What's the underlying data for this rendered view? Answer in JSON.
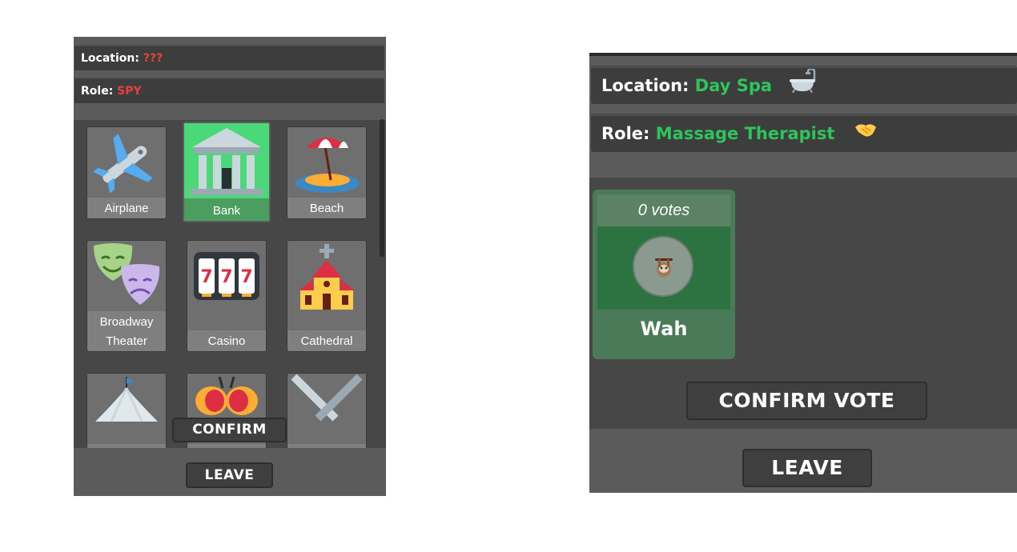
{
  "spy_view": {
    "location": {
      "label": "Location:",
      "value": "???"
    },
    "role": {
      "label": "Role:",
      "value": "SPY"
    },
    "locations": [
      {
        "name": "Airplane",
        "icon": "airplane-icon",
        "selected": false
      },
      {
        "name": "Bank",
        "icon": "bank-icon",
        "selected": true
      },
      {
        "name": "Beach",
        "icon": "beach-umbrella-icon",
        "selected": false
      },
      {
        "name": "Broadway Theater",
        "name_line1": "Broadway",
        "name_line2": "Theater",
        "icon": "theater-masks-icon",
        "selected": false
      },
      {
        "name": "Casino",
        "icon": "slot-machine-icon",
        "selected": false
      },
      {
        "name": "Cathedral",
        "icon": "church-icon",
        "selected": false
      },
      {
        "name": "",
        "icon": "circus-tent-icon",
        "selected": false
      },
      {
        "name": "",
        "icon": "crab-icon",
        "selected": false
      },
      {
        "name": "",
        "icon": "crossed-swords-icon",
        "selected": false
      }
    ],
    "confirm_label": "CONFIRM",
    "leave_label": "LEAVE"
  },
  "player_view": {
    "location": {
      "label": "Location:",
      "value": "Day Spa",
      "icon": "bathtub-icon"
    },
    "role": {
      "label": "Role:",
      "value": "Massage Therapist",
      "icon": "handshake-icon"
    },
    "vote_card": {
      "votes": "0 votes",
      "player": "Wah",
      "avatar_icon": "sloth-icon"
    },
    "confirm_vote_label": "CONFIRM VOTE",
    "leave_label": "LEAVE"
  },
  "colors": {
    "panel": "#5b5b5b",
    "bar": "#3d3d3d",
    "spy_red": "#e8413d",
    "location_green": "#2dc55c",
    "selected_tile": "#4bd879"
  }
}
